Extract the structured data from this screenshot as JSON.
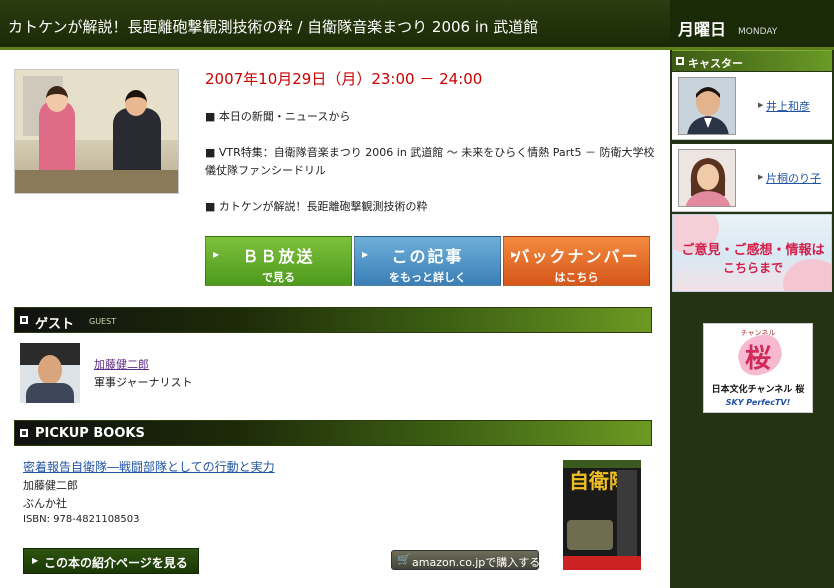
{
  "header": {
    "title": "カトケンが解説！長距離砲撃観測技術の粋 / 自衛隊音楽まつり 2006 in 武道館"
  },
  "episode": {
    "datetime": "2007年10月29日（月）23:00 － 24:00",
    "items": [
      "■ 本日の新聞・ニュースから",
      "■ VTR特集：自衛隊音楽まつり 2006 in 武道館 ～ 未来をひらく情熱 Part5 － 防衛大学校儀仗隊ファンシードリル",
      "■ カトケンが解説！長距離砲撃観測技術の粋"
    ],
    "buttons": [
      {
        "line1": "ＢＢ放送",
        "line2": "で見る"
      },
      {
        "line1": "この記事",
        "line2": "をもっと詳しく"
      },
      {
        "line1": "バックナンバー",
        "line2": "はこちら"
      }
    ]
  },
  "guest_section": {
    "label": "ゲスト",
    "sub": "GUEST",
    "name": "加藤健二郎",
    "role": "軍事ジャーナリスト"
  },
  "books_section": {
    "label": "PICKUP BOOKS",
    "book": {
      "title": "密着報告自衛隊―戦闘部隊としての行動と実力",
      "author": "加藤健二郎",
      "publisher": "ぶんか社",
      "isbn": "ISBN: 978-4821108503",
      "cover_text": "自衛隊"
    },
    "intro_button": "この本の紹介ページを見る",
    "amazon_button": "amazon.co.jpで購入する"
  },
  "sidebar": {
    "day": "月曜日",
    "day_en": "MONDAY",
    "caster_label": "キャスター",
    "casters": [
      {
        "name": "井上和彦"
      },
      {
        "name": "片桐のり子"
      }
    ],
    "opinion_line1": "ご意見・ご感想・情報は",
    "opinion_line2": "こちらまで",
    "channel": {
      "small": "チャンネル",
      "kanji": "桜",
      "name": "日本文化チャンネル 桜",
      "sky": "SKY PerfecTV!"
    }
  },
  "colors": {
    "date_red": "#cc0000",
    "link_blue": "#2156a5",
    "header_dark_green": "#1a2a06",
    "accent_green": "#6c9a23",
    "btn_green": "#4e9a1e",
    "btn_blue": "#3a7fb6",
    "btn_orange": "#d6571b"
  }
}
